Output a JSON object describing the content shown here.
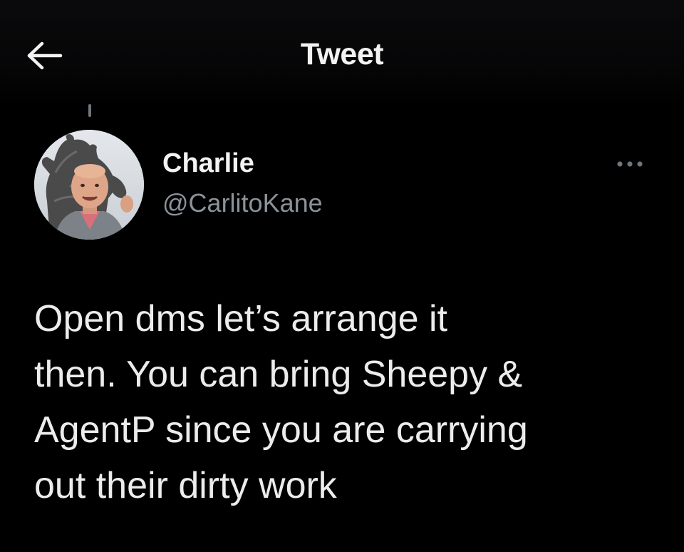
{
  "header": {
    "title": "Tweet",
    "back_icon": "arrow-left-icon"
  },
  "tweet": {
    "author": {
      "name": "Charlie",
      "handle": "@CarlitoKane",
      "avatar": "profile-photo"
    },
    "more_icon": "more-horizontal-icon",
    "text": "Open dms let’s arrange it\nthen. You can bring Sheepy &\nAgentP since you are carrying\nout their dirty work"
  },
  "colors": {
    "background": "#000000",
    "primary_text": "#e7e9ea",
    "secondary_text": "#8b9298"
  }
}
